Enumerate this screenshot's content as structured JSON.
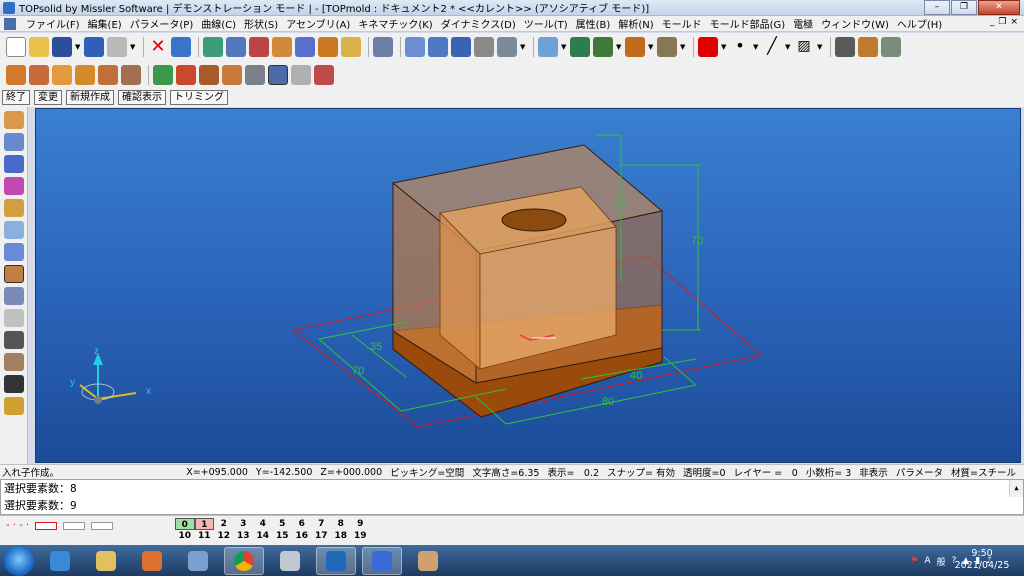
{
  "window": {
    "title": "TOPsolid by Missler Software | デモンストレーション モード | - [TOPmold : ドキュメント2 *  <<カレント>> (アソシアティブ モード)]",
    "controls": [
      "–",
      "❐",
      "✕"
    ]
  },
  "menu": {
    "items": [
      "ファイル(F)",
      "編集(E)",
      "パラメータ(P)",
      "曲線(C)",
      "形状(S)",
      "アセンブリ(A)",
      "キネマチック(K)",
      "ダイナミクス(D)",
      "ツール(T)",
      "属性(B)",
      "解析(N)",
      "モールド",
      "モールド部品(G)",
      "電極",
      "ウィンドウ(W)",
      "ヘルプ(H)"
    ],
    "mdi_controls": [
      "_",
      "❐",
      "×"
    ]
  },
  "command_buttons": [
    "終了",
    "変更",
    "新規作成",
    "確認表示",
    "トリミング"
  ],
  "toolbar": {
    "accent_color": "#e00000",
    "icons_row1": [
      "new-doc",
      "open-folder",
      "save",
      "save-dropdown",
      "info",
      "print",
      "print-dropdown",
      "delete",
      "undo",
      "import",
      "measure",
      "settings",
      "hammer",
      "tool",
      "pin",
      "eye",
      "trim",
      "cut",
      "align",
      "bar",
      "hook",
      "visible",
      "zoom",
      "fit",
      "screen",
      "shade",
      "camera",
      "color",
      "dot",
      "line",
      "hatch",
      "render",
      "copy",
      "paste"
    ],
    "icons_row2": [
      "mold1",
      "mold2",
      "mold3",
      "mold4",
      "mold5",
      "mold6",
      "check",
      "cross",
      "surface",
      "shell",
      "parting",
      "cavity",
      "search",
      "export"
    ]
  },
  "viewport": {
    "background_top": "#3a7fd0",
    "background_bottom": "#1c4b98",
    "axis_labels": {
      "x": "x",
      "y": "y",
      "z": "z"
    },
    "dimensions": {
      "d60": "60",
      "d70v": "70",
      "d35": "35",
      "d70h": "70",
      "d40": "40",
      "d80": "80"
    }
  },
  "status": {
    "left": "入れ子作成。",
    "items": [
      "X=+095.000",
      "Y=-142.500",
      "Z=+000.000",
      "ピッキング=空間",
      "文字高さ=6.35",
      "表示=　0.2",
      "スナップ= 有効",
      "透明度=0",
      "レイヤー =　0",
      "小数桁= 3",
      "非表示",
      "パラメータ",
      "材質=スチール"
    ]
  },
  "output": {
    "lines": [
      "選択要素数：8",
      "選択要素数：9"
    ]
  },
  "layers": {
    "row1": [
      "0",
      "1",
      "2",
      "3",
      "4",
      "5",
      "6",
      "7",
      "8",
      "9"
    ],
    "row2": [
      "10",
      "11",
      "12",
      "13",
      "14",
      "15",
      "16",
      "17",
      "18",
      "19"
    ]
  },
  "taskbar": {
    "apps": [
      "internet-explorer",
      "file-explorer",
      "media-player",
      "drawing-app",
      "chrome",
      "calculator",
      "outlook",
      "topsolid",
      "paint"
    ],
    "tray": [
      "A",
      "般"
    ],
    "time": "9:50",
    "date": "2021/04/25"
  }
}
